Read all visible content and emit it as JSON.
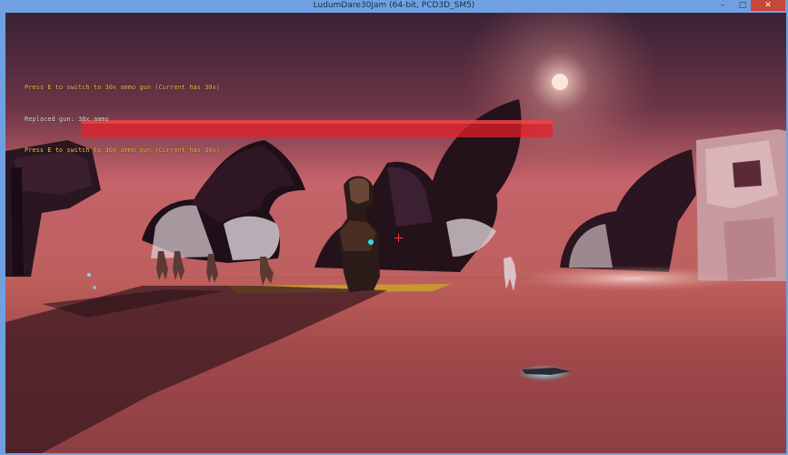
{
  "window": {
    "title": "LudumDare30Jam (64-bit, PCD3D_SM5)",
    "controls": {
      "minimize": "–",
      "maximize": "□",
      "close": "✕"
    }
  },
  "hud": {
    "messages": [
      {
        "text": "Press E to switch to 30x ammo gun (Current has 30x)",
        "tone": "yellow"
      },
      {
        "text": "Replaced gun: 30x ammo",
        "tone": "white"
      },
      {
        "text": "Press E to switch to 30x ammo gun (Current has 30x)",
        "tone": "yellow"
      }
    ],
    "health_bar": {
      "color": "#e8202a"
    },
    "crosshair_color": "#ff3a3a"
  },
  "scene": {
    "sky_top": "#3a2236",
    "sky_horizon": "#c7646a",
    "ground": "#a4494a",
    "sun_color": "#fbe7d8"
  }
}
